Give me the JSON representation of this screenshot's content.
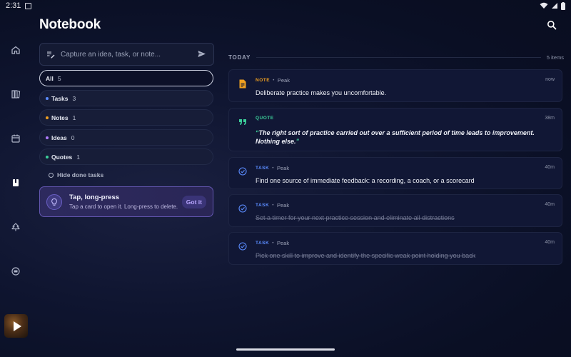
{
  "status": {
    "time": "2:31"
  },
  "rail": {
    "items": [
      {
        "icon": "home-icon",
        "name": "nav-home"
      },
      {
        "icon": "library-icon",
        "name": "nav-library"
      },
      {
        "icon": "calendar-icon",
        "name": "nav-calendar"
      },
      {
        "icon": "notebook-icon",
        "name": "nav-notebook"
      },
      {
        "icon": "tree-icon",
        "name": "nav-tree"
      },
      {
        "icon": "badge-icon",
        "name": "nav-badge"
      }
    ]
  },
  "header": {
    "title": "Notebook"
  },
  "capture": {
    "placeholder": "Capture an idea, task, or note..."
  },
  "filters": [
    {
      "label": "All",
      "count": "5",
      "color": ""
    },
    {
      "label": "Tasks",
      "count": "3",
      "color": "#5b8cff"
    },
    {
      "label": "Notes",
      "count": "1",
      "color": "#f0a020"
    },
    {
      "label": "Ideas",
      "count": "0",
      "color": "#b07cff"
    },
    {
      "label": "Quotes",
      "count": "1",
      "color": "#3ccf9a"
    }
  ],
  "hide_done": "Hide done tasks",
  "tip": {
    "title": "Tap, long-press",
    "desc": "Tap a card to open it. Long-press to delete.",
    "button": "Got it"
  },
  "section": {
    "label": "TODAY",
    "count": "5 items"
  },
  "separator": "•",
  "quote_marks": {
    "open": "“",
    "close": "”"
  },
  "cards": [
    {
      "type": "NOTE",
      "color": "#f0a020",
      "source": "Peak",
      "time": "now",
      "text": "Deliberate practice makes you uncomfortable.",
      "done": false
    },
    {
      "type": "QUOTE",
      "color": "#3ccf9a",
      "source": "",
      "time": "38m",
      "text": "The right sort of practice  carried out over a sufficient period of time leads to improvement. Nothing else.",
      "done": false
    },
    {
      "type": "TASK",
      "color": "#5b8cff",
      "source": "Peak",
      "time": "40m",
      "text": "Find one source of immediate feedback: a recording, a coach, or a scorecard",
      "done": false
    },
    {
      "type": "TASK",
      "color": "#5b8cff",
      "source": "Peak",
      "time": "40m",
      "text": "Set a timer for your next practice session and eliminate all distractions",
      "done": true
    },
    {
      "type": "TASK",
      "color": "#5b8cff",
      "source": "Peak",
      "time": "40m",
      "text": "Pick one skill to improve and identify the specific weak point holding you back",
      "done": true
    }
  ]
}
